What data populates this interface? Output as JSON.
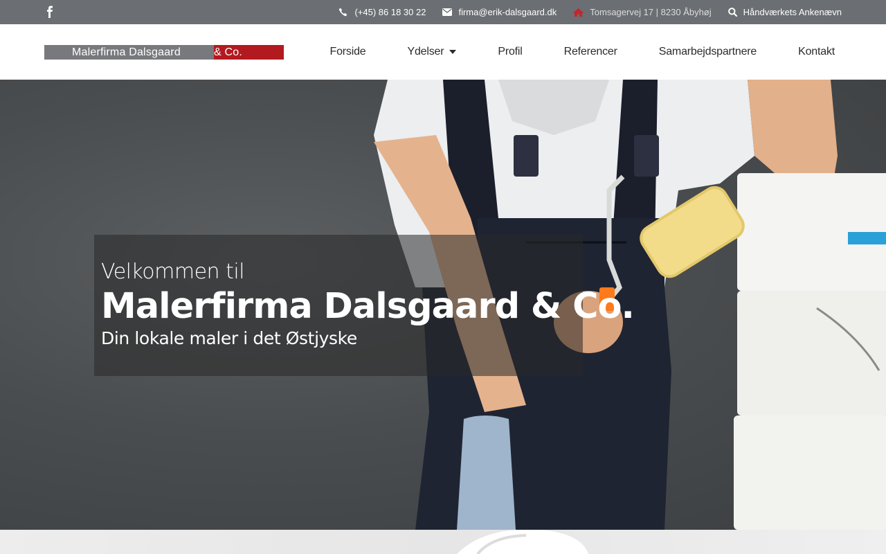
{
  "topbar": {
    "icons": {
      "facebook": "facebook-icon",
      "phone": "phone-icon",
      "email": "envelope-icon",
      "address": "home-icon",
      "search": "search-icon"
    },
    "phone": "(+45) 86 18 30 22",
    "email": "firma@erik-dalsgaard.dk",
    "address": "Tomsagervej 17 | 8230 Åbyhøj",
    "complaints": "Håndværkets Ankenævn",
    "colors": {
      "background": "#6b6e72",
      "home_icon": "#c0282d"
    }
  },
  "header": {
    "logo": {
      "text_main": "Malerfirma Dalsgaard",
      "text_accent": "& Co.",
      "colors": {
        "gray": "#77797d",
        "red": "#b21a20"
      }
    },
    "nav": [
      {
        "label": "Forside"
      },
      {
        "label": "Ydelser",
        "has_dropdown": true
      },
      {
        "label": "Profil"
      },
      {
        "label": "Referencer"
      },
      {
        "label": "Samarbejdspartnere"
      },
      {
        "label": "Kontakt"
      }
    ]
  },
  "hero": {
    "pre_title": "Velkommen til",
    "title": "Malerfirma Dalsgaard & Co.",
    "subtitle": "Din lokale maler i det Østjyske"
  }
}
